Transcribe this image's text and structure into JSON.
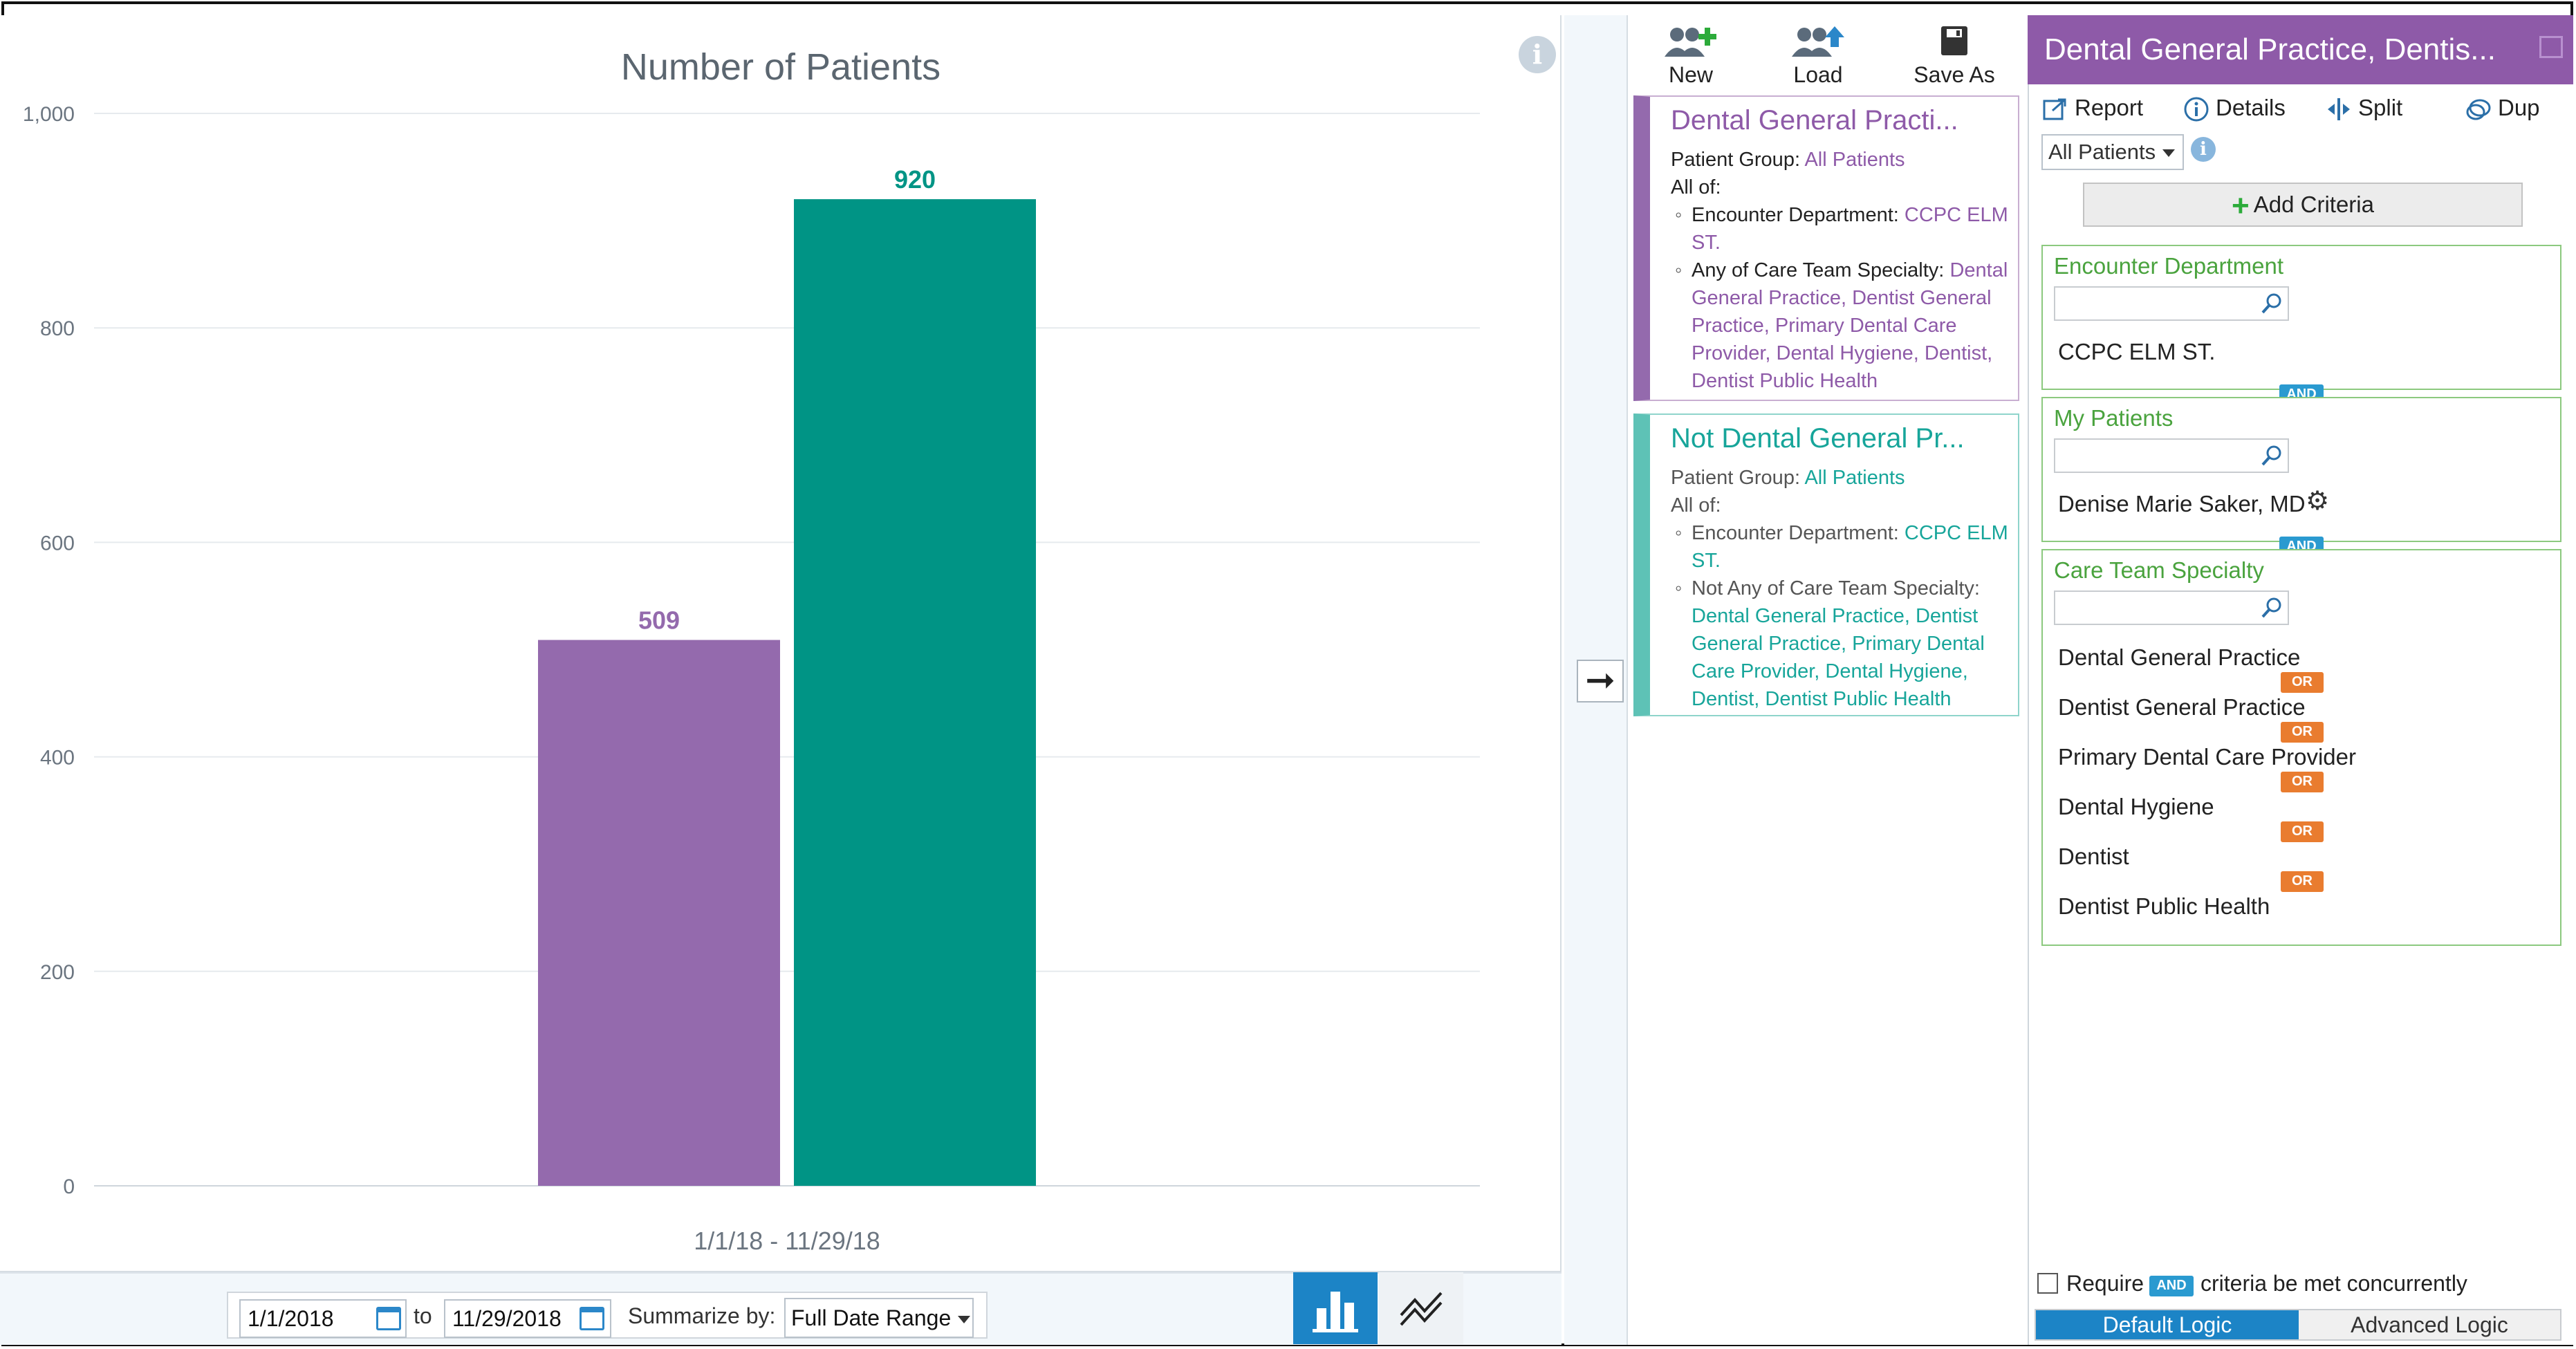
{
  "chart_panel": {
    "info_icon": "info-icon",
    "bottom_toolbar": {
      "start_date": "1/1/2018",
      "to_label": "to",
      "end_date": "11/29/2018",
      "summarize_label": "Summarize by:",
      "summarize_value": "Full Date Range",
      "bar_view_icon": "bar-chart-icon",
      "line_view_icon": "line-chart-icon"
    }
  },
  "chart_data": {
    "type": "bar",
    "title": "Number of Patients",
    "xlabel": "",
    "ylabel": "",
    "categories": [
      "1/1/18 - 11/29/18"
    ],
    "series": [
      {
        "name": "Dental General Practi...",
        "values": [
          509
        ],
        "color": "#946aad"
      },
      {
        "name": "Not Dental General Pr...",
        "values": [
          920
        ],
        "color": "#009485"
      }
    ],
    "ylim": [
      0,
      1000
    ],
    "yticks": [
      "0",
      "200",
      "400",
      "600",
      "800",
      "1,000"
    ],
    "data_labels": [
      "509",
      "920"
    ],
    "grid": true,
    "legend": "none"
  },
  "arrow_button": {
    "icon": "arrow-right-icon"
  },
  "middle": {
    "tools": [
      {
        "label": "New",
        "icon": "new-group-icon"
      },
      {
        "label": "Load",
        "icon": "load-group-icon"
      },
      {
        "label": "Save As",
        "icon": "save-icon"
      }
    ],
    "groups": [
      {
        "title": "Dental General Practi...",
        "patient_group_label": "Patient Group:",
        "patient_group_value": "All Patients",
        "all_of": "All of:",
        "items": [
          {
            "label": "Encounter Department:",
            "value": "CCPC ELM ST."
          },
          {
            "label": "Any of Care Team Specialty:",
            "value": "Dental General Practice, Dentist General Practice, Primary Dental Care Provider, Dental Hygiene, Dentist, Dentist Public Health"
          }
        ],
        "color": "#8e5aa8"
      },
      {
        "title": "Not Dental General Pr...",
        "patient_group_label": "Patient Group:",
        "patient_group_value": "All Patients",
        "all_of": "All of:",
        "items": [
          {
            "label": "Encounter Department:",
            "value": "CCPC ELM ST."
          },
          {
            "label": "Not Any of Care Team Specialty:",
            "value": "Dental General Practice, Dentist General Practice, Primary Dental Care Provider, Dental Hygiene, Dentist, Dentist Public Health"
          }
        ],
        "color": "#17a59a"
      }
    ]
  },
  "right": {
    "header_title": "Dental General Practice, Dentis...",
    "actions": [
      {
        "label": "Report",
        "icon": "report-export-icon"
      },
      {
        "label": "Details",
        "icon": "details-info-icon"
      },
      {
        "label": "Split",
        "icon": "split-icon"
      },
      {
        "label": "Dup",
        "icon": "duplicate-icon"
      }
    ],
    "patients_filter": "All Patients",
    "add_criteria": "Add Criteria",
    "criteria": [
      {
        "title": "Encounter Department",
        "values": [
          "CCPC ELM ST."
        ]
      },
      {
        "title": "My Patients",
        "values": [
          "Denise Marie Saker, MD"
        ]
      },
      {
        "title": "Care Team Specialty",
        "values": [
          "Dental General Practice",
          "Dentist General Practice",
          "Primary Dental Care Provider",
          "Dental Hygiene",
          "Dentist",
          "Dentist Public Health"
        ]
      }
    ],
    "and_badge": "AND",
    "or_badge": "OR",
    "footer": {
      "require_label": "Require",
      "and_badge": "AND",
      "concurrent_label": "criteria be met concurrently",
      "default_logic": "Default Logic",
      "advanced_logic": "Advanced Logic"
    },
    "accent": "#8e5aa8"
  }
}
